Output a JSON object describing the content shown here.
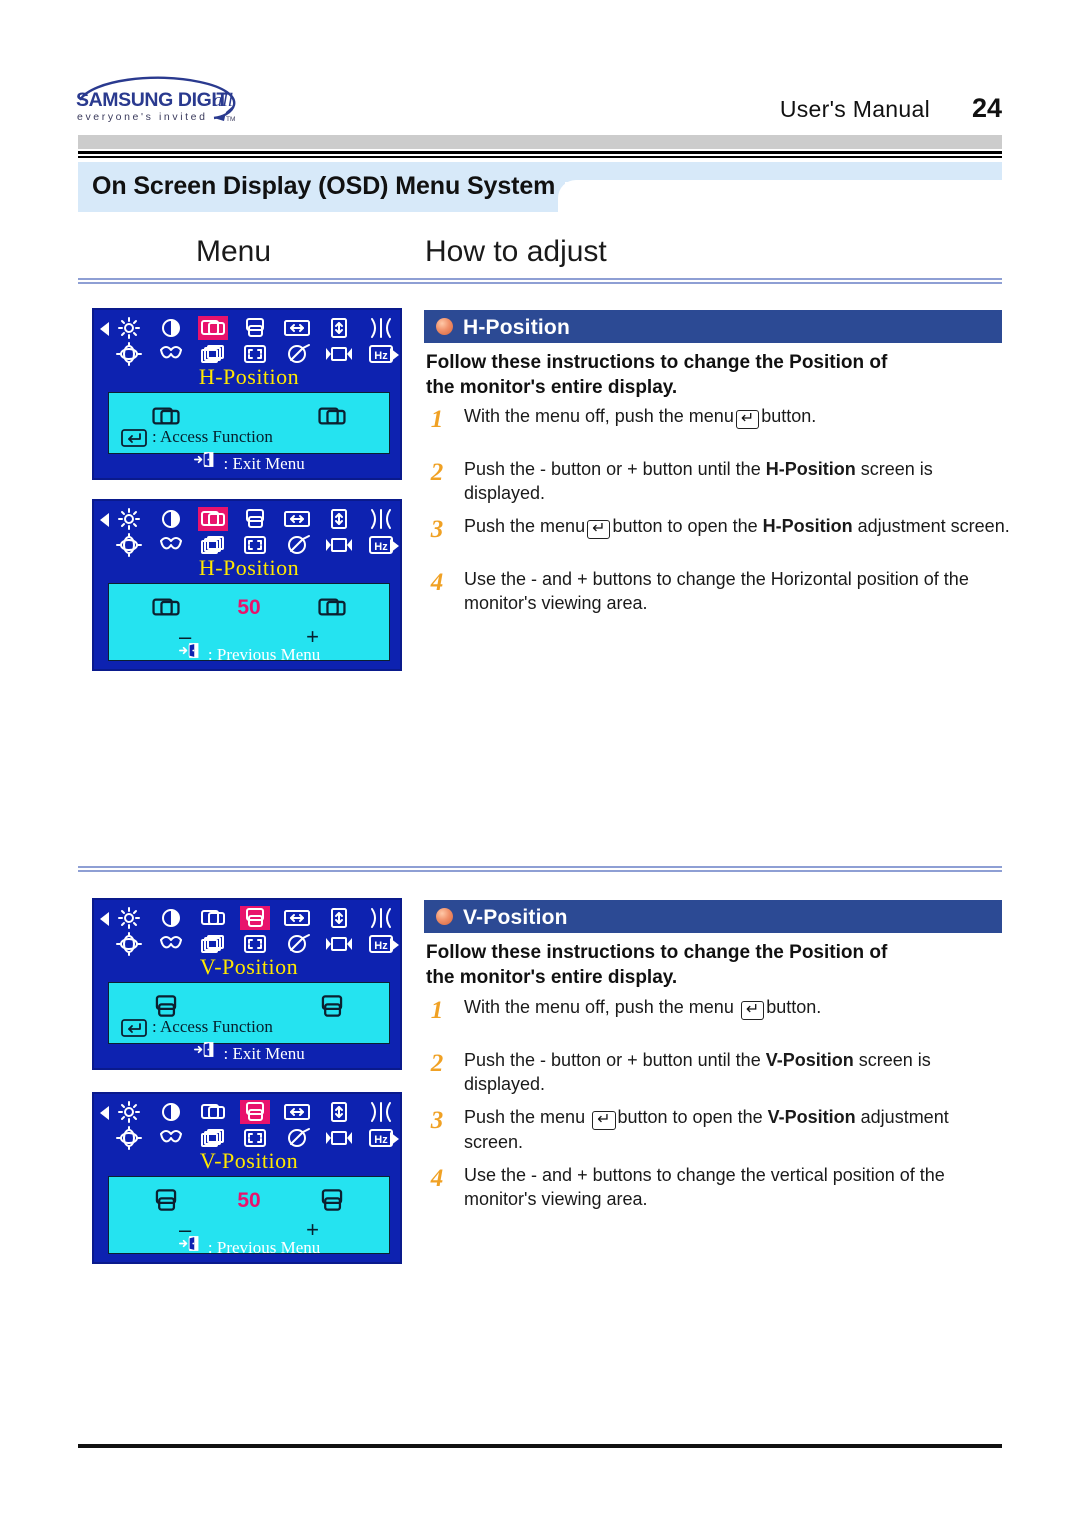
{
  "header": {
    "logo_main": "SAMSUNG DIGITall",
    "logo_tagline": "everyone's invited",
    "logo_tm": "TM",
    "manual_label": "User's  Manual",
    "page_number": "24"
  },
  "banner": {
    "title": "On Screen Display (OSD) Menu System"
  },
  "columns": {
    "menu": "Menu",
    "how_to_adjust": "How to adjust"
  },
  "colors": {
    "banner_bg": "#d7e9f9",
    "section_header_bg": "#2c4a94",
    "osd_bg": "#0d22b0",
    "osd_inner_bg": "#25e3f0",
    "osd_label_text": "#ffe800",
    "osd_highlight": "#e8136c",
    "step_number": "#f0a124",
    "rule_blue": "#8e9fd4",
    "gray_band": "#cccccc"
  },
  "osd_panels": [
    {
      "id": "h-position-menu",
      "label": "H-Position",
      "highlight_index": 2,
      "access_line": ": Access Function",
      "access_icon": "enter-key-icon",
      "footer": ": Exit Menu",
      "footer_icon": "exit-door-icon",
      "mode": "menu"
    },
    {
      "id": "h-position-adjust",
      "label": "H-Position",
      "highlight_index": 2,
      "value": "50",
      "minus": "–",
      "plus": "+",
      "footer": ": Previous Menu",
      "footer_icon": "exit-door-icon",
      "mode": "adjust"
    },
    {
      "id": "v-position-menu",
      "label": "V-Position",
      "highlight_index": 3,
      "access_line": ": Access Function",
      "access_icon": "enter-key-icon",
      "footer": ": Exit Menu",
      "footer_icon": "exit-door-icon",
      "mode": "menu"
    },
    {
      "id": "v-position-adjust",
      "label": "V-Position",
      "highlight_index": 3,
      "value": "50",
      "minus": "–",
      "plus": "+",
      "footer": ": Previous Menu",
      "footer_icon": "exit-door-icon",
      "mode": "adjust"
    }
  ],
  "osd_icon_names": {
    "row1": [
      "brightness-icon",
      "contrast-icon",
      "h-position-icon",
      "v-position-icon",
      "h-size-icon",
      "v-size-icon",
      "pincushion-icon"
    ],
    "row2": [
      "rotation-icon",
      "trapezoid-icon",
      "parallelogram-icon",
      "zoom-icon",
      "degauss-icon",
      "recall-icon",
      "frequency-hz-icon"
    ]
  },
  "sections": [
    {
      "id": "h-position",
      "title": "H-Position",
      "lead": "Follow these instructions to change the  Position of the monitor's entire display.",
      "lead_line1": "Follow these instructions to change the  Position of",
      "lead_line2": "the monitor's entire display.",
      "steps": [
        {
          "num": "1",
          "parts": [
            {
              "t": "text",
              "v": "With the menu off, push the menu"
            },
            {
              "t": "key",
              "v": "↵"
            },
            {
              "t": "text",
              "v": "button."
            }
          ]
        },
        {
          "num": "2",
          "parts": [
            {
              "t": "text",
              "v": "Push the  - button or  + button until the "
            },
            {
              "t": "bold",
              "v": "H-Position"
            },
            {
              "t": "text",
              "v": " screen is displayed."
            }
          ]
        },
        {
          "num": "3",
          "parts": [
            {
              "t": "text",
              "v": "Push the menu"
            },
            {
              "t": "key",
              "v": "↵"
            },
            {
              "t": "text",
              "v": "button to open the "
            },
            {
              "t": "bold",
              "v": "H-Position"
            },
            {
              "t": "text",
              "v": " adjustment screen."
            }
          ]
        },
        {
          "num": "4",
          "parts": [
            {
              "t": "text",
              "v": "Use the  - and  + buttons to change the Horizontal position of the monitor's viewing area."
            }
          ]
        }
      ]
    },
    {
      "id": "v-position",
      "title": "V-Position",
      "lead": "Follow these instructions to change the  Position of the monitor's entire display.",
      "lead_line1": "Follow these instructions to change the  Position of",
      "lead_line2": "the monitor's entire display.",
      "steps": [
        {
          "num": "1",
          "parts": [
            {
              "t": "text",
              "v": "With the menu off, push the menu "
            },
            {
              "t": "key",
              "v": "↵"
            },
            {
              "t": "text",
              "v": "button."
            }
          ]
        },
        {
          "num": "2",
          "parts": [
            {
              "t": "text",
              "v": "Push the  - button or  + button until the "
            },
            {
              "t": "bold",
              "v": "V-Position"
            },
            {
              "t": "text",
              "v": "  screen is displayed."
            }
          ]
        },
        {
          "num": "3",
          "parts": [
            {
              "t": "text",
              "v": "Push the menu "
            },
            {
              "t": "key",
              "v": "↵"
            },
            {
              "t": "text",
              "v": "button to open the "
            },
            {
              "t": "bold",
              "v": "V-Position"
            },
            {
              "t": "text",
              "v": " adjustment screen."
            }
          ]
        },
        {
          "num": "4",
          "parts": [
            {
              "t": "text",
              "v": "Use the  - and  + buttons to change the vertical position of the monitor's viewing area."
            }
          ]
        }
      ]
    }
  ]
}
